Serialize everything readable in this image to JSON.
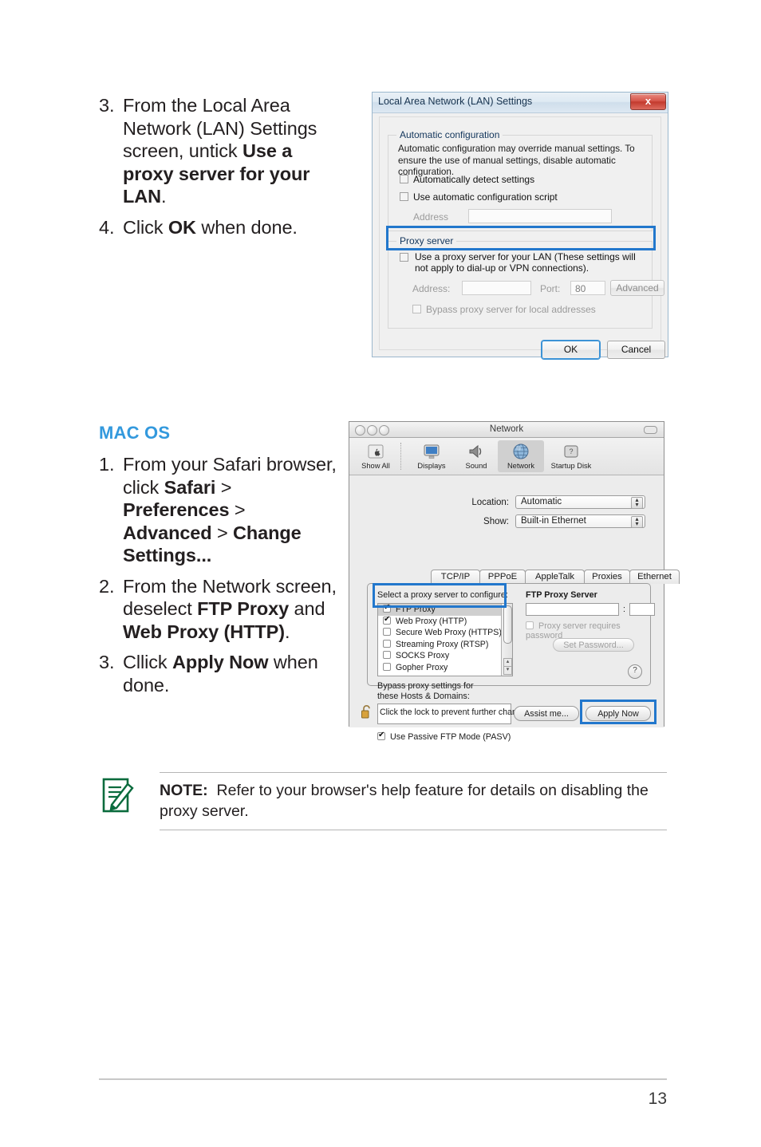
{
  "windows_section": {
    "steps": [
      {
        "num": "3.",
        "html": "From the Local Area Network (LAN) Settings screen, untick <b>Use a proxy server for your LAN</b>."
      },
      {
        "num": "4.",
        "html": "Click <b>OK</b> when done."
      }
    ]
  },
  "mac_section": {
    "heading": "MAC OS",
    "steps": [
      {
        "num": "1.",
        "html": "From your Safari browser, click <b>Safari</b> &gt; <b>Preferences</b> &gt; <b>Advanced</b> &gt; <b>Change Settings...</b>"
      },
      {
        "num": "2.",
        "html": "From the Network screen, deselect <b>FTP Proxy</b> and <b>Web Proxy (HTTP)</b>."
      },
      {
        "num": "3.",
        "html": "Cllick <b>Apply Now</b> when done."
      }
    ]
  },
  "win_dialog": {
    "title": "Local Area Network (LAN) Settings",
    "close_label": "x",
    "auto_group_label": "Automatic configuration",
    "auto_description": "Automatic configuration may override manual settings.  To ensure the use of manual settings, disable automatic configuration.",
    "auto_detect_label": "Automatically detect settings",
    "auto_script_label": "Use automatic configuration script",
    "address_label": "Address",
    "address_value": "",
    "proxy_group_label": "Proxy server",
    "proxy_checkbox_label": "Use a proxy server for your LAN (These settings will not apply to dial-up or VPN connections).",
    "proxy_address_label": "Address:",
    "proxy_address_value": "",
    "port_label": "Port:",
    "port_value": "80",
    "advanced_label": "Advanced",
    "bypass_label": "Bypass proxy server for local addresses",
    "ok_label": "OK",
    "cancel_label": "Cancel"
  },
  "mac_dialog": {
    "title": "Network",
    "toolbar": [
      {
        "label": "Show All",
        "icon": "apple-icon"
      },
      {
        "label": "Displays",
        "icon": "display-icon"
      },
      {
        "label": "Sound",
        "icon": "speaker-icon"
      },
      {
        "label": "Network",
        "icon": "globe-icon"
      },
      {
        "label": "Startup Disk",
        "icon": "hard-disk-icon"
      }
    ],
    "location_label": "Location:",
    "location_value": "Automatic",
    "show_label": "Show:",
    "show_value": "Built-in Ethernet",
    "tabs": [
      "TCP/IP",
      "PPPoE",
      "AppleTalk",
      "Proxies",
      "Ethernet"
    ],
    "select_proxy_label": "Select a proxy server to configure:",
    "proxy_list": [
      {
        "label": "FTP Proxy",
        "checked": true,
        "selected": true
      },
      {
        "label": "Web Proxy (HTTP)",
        "checked": true,
        "selected": false
      },
      {
        "label": "Secure Web Proxy (HTTPS)",
        "checked": false,
        "selected": false
      },
      {
        "label": "Streaming Proxy (RTSP)",
        "checked": false,
        "selected": false
      },
      {
        "label": "SOCKS Proxy",
        "checked": false,
        "selected": false
      },
      {
        "label": "Gopher Proxy",
        "checked": false,
        "selected": false
      }
    ],
    "ftp_proxy_server_label": "FTP Proxy Server",
    "ftp_proxy_host_value": "",
    "ftp_proxy_port_value": "",
    "port_separator": ":",
    "requires_password_label": "Proxy server requires password",
    "set_password_label": "Set Password...",
    "bypass_label_line1": "Bypass proxy settings for",
    "bypass_label_line2": "these Hosts & Domains:",
    "bypass_value": "",
    "passive_ftp_label": "Use Passive FTP Mode (PASV)",
    "help_label": "?",
    "lock_text": "Click the lock to prevent further changes.",
    "assist_label": "Assist me...",
    "apply_label": "Apply Now"
  },
  "note": {
    "label": "NOTE:",
    "text": "Refer to your browser's help feature for details on disabling the proxy server."
  },
  "footer": {
    "page_number": "13"
  },
  "colors": {
    "heading_blue": "#3399dd",
    "highlight_blue": "#2277cc",
    "note_green": "#0a6b3d",
    "close_red": "#c23a2e"
  }
}
